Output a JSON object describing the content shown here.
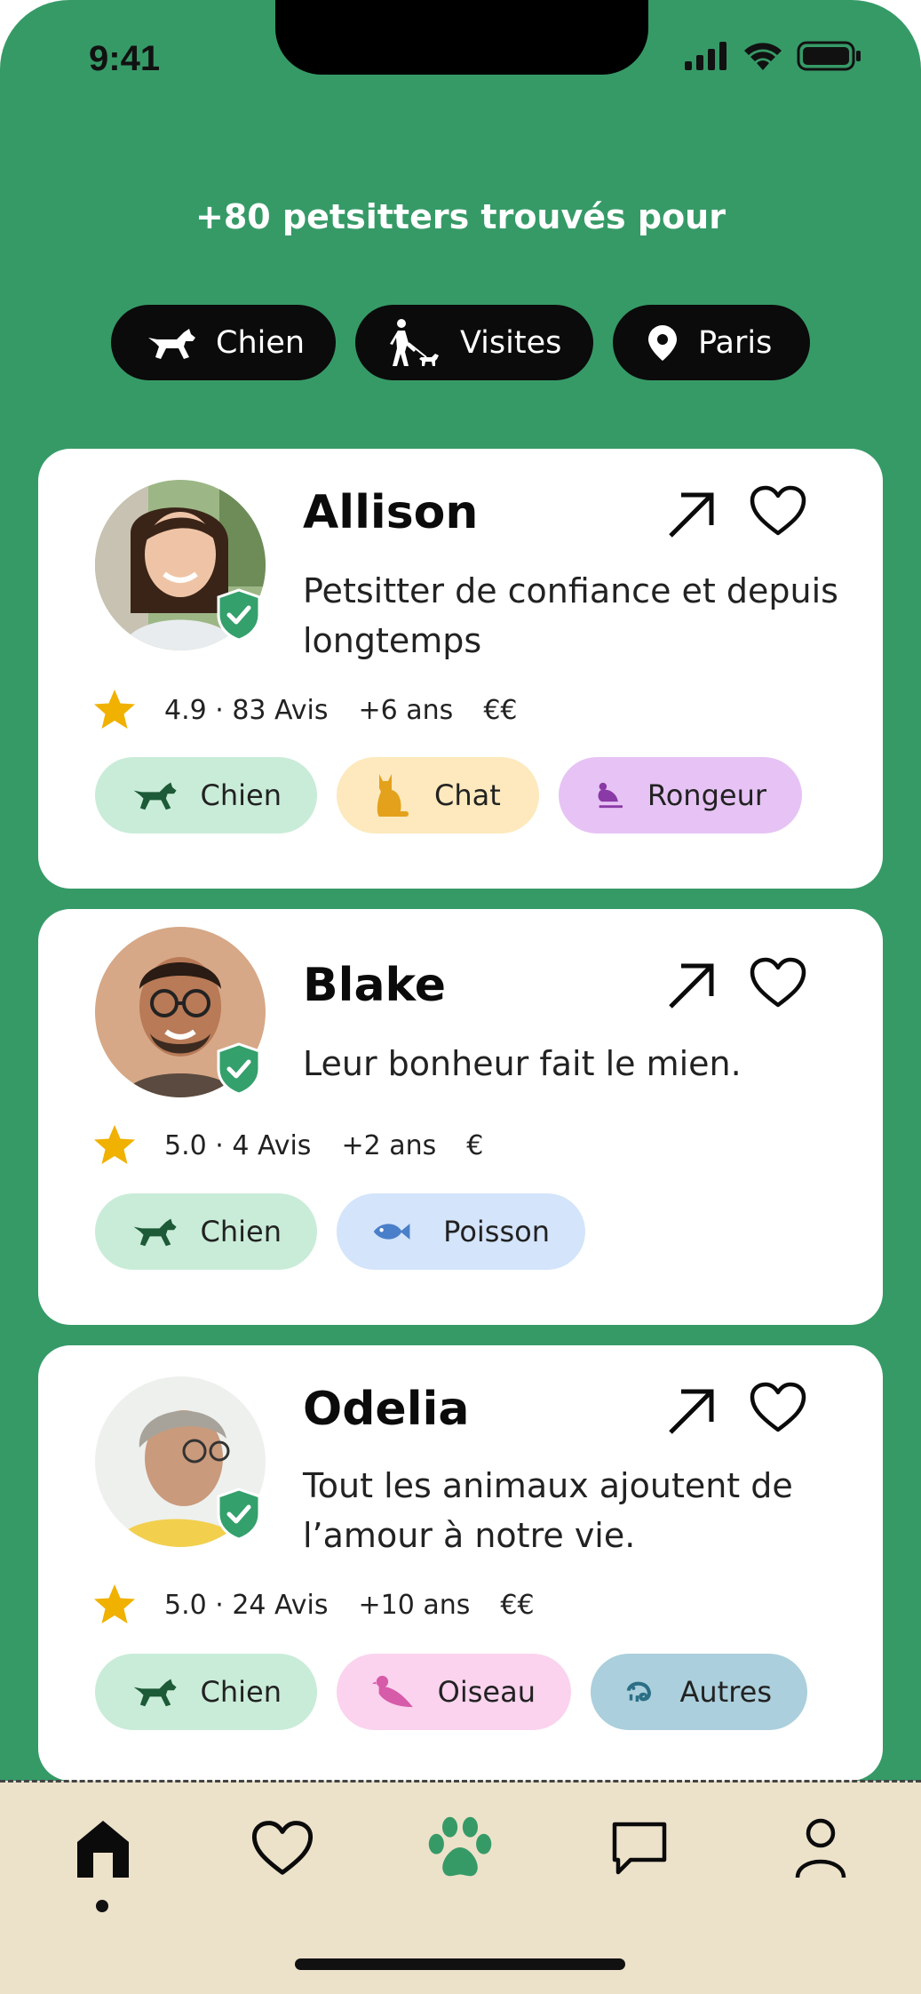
{
  "status": {
    "time": "9:41"
  },
  "headline": "+80 petsitters trouvés pour",
  "filters": [
    {
      "label": "Chien",
      "icon": "dog-icon"
    },
    {
      "label": "Visites",
      "icon": "walker-icon"
    },
    {
      "label": "Paris",
      "icon": "location-pin-icon"
    }
  ],
  "sitters": [
    {
      "name": "Allison",
      "description": "Petsitter de confiance et depuis longtemps",
      "rating": "4.9 · 83 Avis",
      "experience": "+6 ans",
      "price": "€€",
      "tags": [
        {
          "label": "Chien",
          "icon": "dog-icon",
          "color": "#c9ecd8"
        },
        {
          "label": "Chat",
          "icon": "cat-icon",
          "color": "#fde9bd"
        },
        {
          "label": "Rongeur",
          "icon": "rodent-icon",
          "color": "#e6c3f4"
        }
      ]
    },
    {
      "name": "Blake",
      "description": "Leur bonheur fait le mien.",
      "rating": "5.0 · 4 Avis",
      "experience": "+2 ans",
      "price": "€",
      "tags": [
        {
          "label": "Chien",
          "icon": "dog-icon",
          "color": "#c9ecd8"
        },
        {
          "label": "Poisson",
          "icon": "fish-icon",
          "color": "#d3e4fb"
        }
      ]
    },
    {
      "name": "Odelia",
      "description": "Tout les animaux ajoutent de l’amour à notre vie.",
      "rating": "5.0 · 24 Avis",
      "experience": "+10 ans",
      "price": "€€",
      "tags": [
        {
          "label": "Chien",
          "icon": "dog-icon",
          "color": "#c9ecd8"
        },
        {
          "label": "Oiseau",
          "icon": "bird-icon",
          "color": "#fbd3ee"
        },
        {
          "label": "Autres",
          "icon": "chameleon-icon",
          "color": "#abcfdc"
        }
      ]
    }
  ],
  "nav": [
    "home-icon",
    "heart-icon",
    "paw-icon",
    "chat-icon",
    "profile-icon"
  ],
  "colors": {
    "background": "#369a67",
    "nav": "#ece2ca",
    "star": "#f0b100",
    "verified": "#34a06c"
  }
}
